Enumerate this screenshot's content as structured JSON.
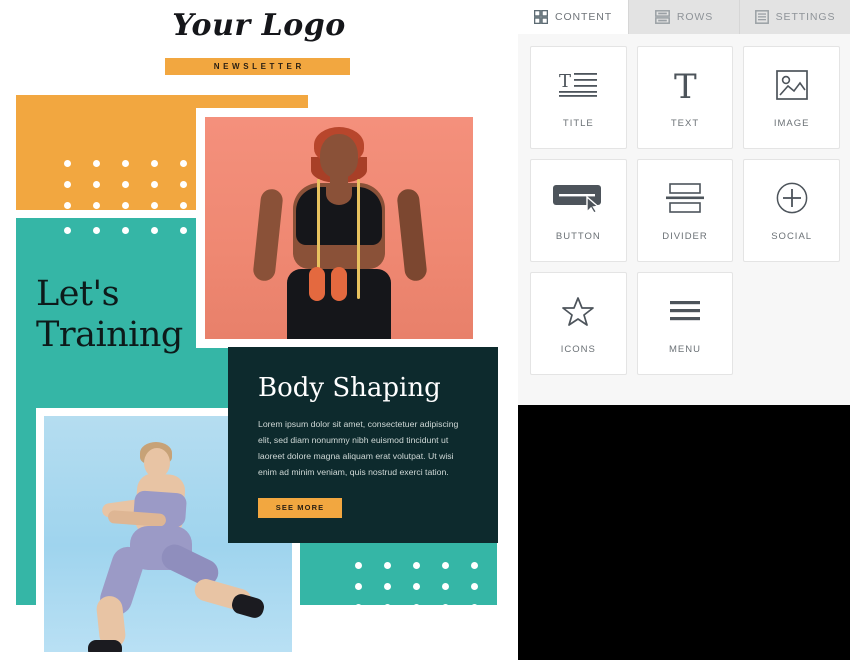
{
  "preview": {
    "logo": "Your Logo",
    "newsletter_label": "NEWSLETTER",
    "headline": "Let's Training",
    "card": {
      "title": "Body Shaping",
      "body": "Lorem ipsum dolor sit amet, consectetuer adipiscing elit, sed diam nonummy nibh euismod tincidunt ut laoreet dolore magna aliquam erat volutpat. Ut wisi enim ad minim veniam, quis nostrud exerci tation.",
      "cta_label": "SEE MORE"
    },
    "colors": {
      "orange": "#f2a740",
      "teal": "#35b6a6",
      "dark_card": "#0d2a2d",
      "coral": "#ef8872",
      "light_blue": "#9fd4ee",
      "dot": "#ffffff"
    },
    "dot_grids": [
      {
        "name": "orange-block-dots",
        "cols": 5,
        "rows": 3
      },
      {
        "name": "teal-block-dots",
        "cols": 5,
        "rows": 1
      },
      {
        "name": "bottom-teal-dots",
        "cols": 5,
        "rows": 3
      }
    ],
    "images": [
      {
        "name": "hero-photo",
        "alt": "Smiling woman with jump rope on coral background"
      },
      {
        "name": "secondary-photo",
        "alt": "Woman performing a lunge on light blue background"
      }
    ]
  },
  "panel": {
    "tabs": [
      {
        "id": "content",
        "label": "CONTENT",
        "icon": "grid-icon",
        "active": true
      },
      {
        "id": "rows",
        "label": "ROWS",
        "icon": "rows-icon",
        "active": false
      },
      {
        "id": "settings",
        "label": "SETTINGS",
        "icon": "settings-icon",
        "active": false
      }
    ],
    "blocks": [
      {
        "id": "title",
        "label": "TITLE",
        "icon": "title-icon"
      },
      {
        "id": "text",
        "label": "TEXT",
        "icon": "text-icon"
      },
      {
        "id": "image",
        "label": "IMAGE",
        "icon": "image-icon"
      },
      {
        "id": "button",
        "label": "BUTTON",
        "icon": "button-icon"
      },
      {
        "id": "divider",
        "label": "DIVIDER",
        "icon": "divider-icon"
      },
      {
        "id": "social",
        "label": "SOCIAL",
        "icon": "social-icon"
      },
      {
        "id": "icons",
        "label": "ICONS",
        "icon": "star-icon"
      },
      {
        "id": "menu",
        "label": "MENU",
        "icon": "menu-icon"
      }
    ],
    "colors": {
      "tab_bar": "#e3e3e3",
      "tab_active": "#ffffff",
      "panel_bg": "#f7f7f7",
      "block_bg": "#ffffff",
      "black_area": "#000000"
    }
  }
}
